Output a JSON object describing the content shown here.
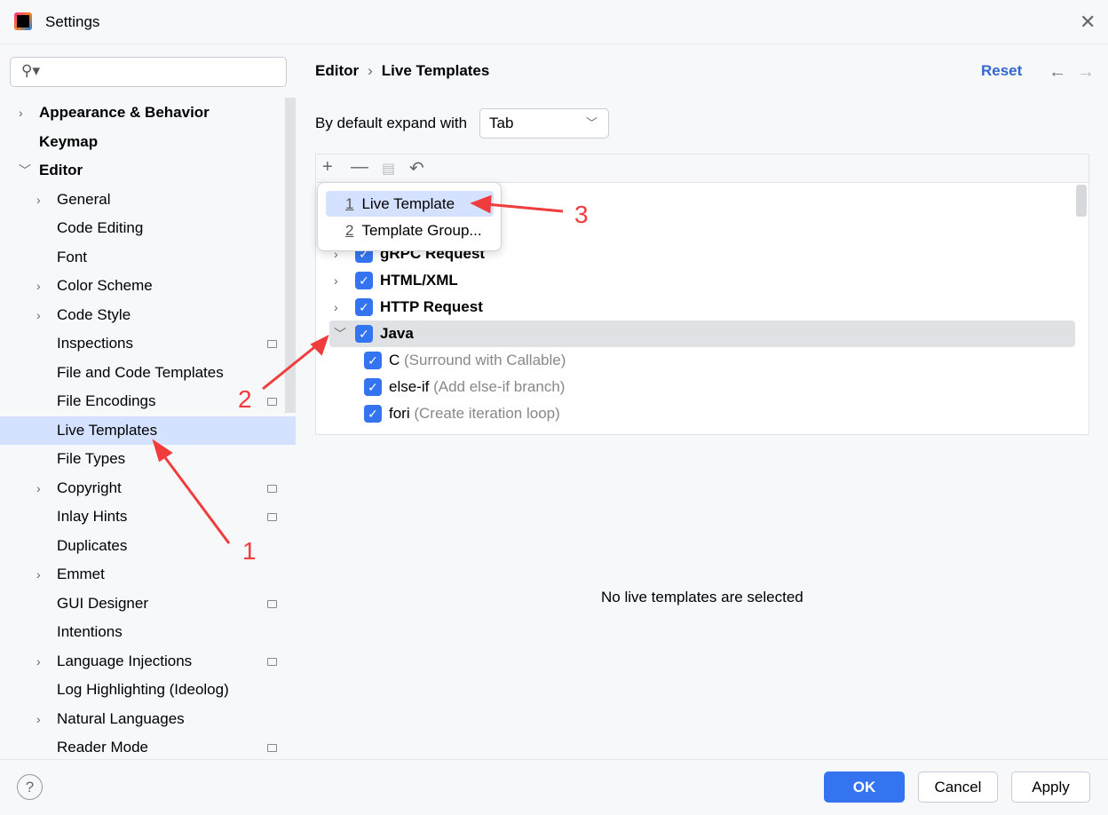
{
  "window": {
    "title": "Settings"
  },
  "search": {
    "placeholder": ""
  },
  "sidebar": {
    "items": [
      {
        "label": "Appearance & Behavior",
        "bold": true,
        "chev": ">",
        "indent": 0
      },
      {
        "label": "Keymap",
        "bold": true,
        "indent": 0
      },
      {
        "label": "Editor",
        "bold": true,
        "chev": "v",
        "indent": 0
      },
      {
        "label": "General",
        "chev": ">",
        "indent": 1
      },
      {
        "label": "Code Editing",
        "indent": 1
      },
      {
        "label": "Font",
        "indent": 1
      },
      {
        "label": "Color Scheme",
        "chev": ">",
        "indent": 1
      },
      {
        "label": "Code Style",
        "chev": ">",
        "indent": 1
      },
      {
        "label": "Inspections",
        "indent": 1,
        "pin": true
      },
      {
        "label": "File and Code Templates",
        "indent": 1
      },
      {
        "label": "File Encodings",
        "indent": 1,
        "pin": true
      },
      {
        "label": "Live Templates",
        "indent": 1,
        "selected": true
      },
      {
        "label": "File Types",
        "indent": 1
      },
      {
        "label": "Copyright",
        "chev": ">",
        "indent": 1,
        "pin": true
      },
      {
        "label": "Inlay Hints",
        "indent": 1,
        "pin": true
      },
      {
        "label": "Duplicates",
        "indent": 1
      },
      {
        "label": "Emmet",
        "chev": ">",
        "indent": 1
      },
      {
        "label": "GUI Designer",
        "indent": 1,
        "pin": true
      },
      {
        "label": "Intentions",
        "indent": 1
      },
      {
        "label": "Language Injections",
        "chev": ">",
        "indent": 1,
        "pin": true
      },
      {
        "label": "Log Highlighting (Ideolog)",
        "indent": 1
      },
      {
        "label": "Natural Languages",
        "chev": ">",
        "indent": 1
      },
      {
        "label": "Reader Mode",
        "indent": 1,
        "pin": true
      }
    ]
  },
  "header": {
    "breadcrumb": [
      "Editor",
      "Live Templates"
    ],
    "reset": "Reset"
  },
  "expand": {
    "label": "By default expand with",
    "value": "Tab"
  },
  "tree": {
    "rows": [
      {
        "name": "gRPC Request",
        "group": true,
        "chev": ">"
      },
      {
        "name": "HTML/XML",
        "group": true,
        "chev": ">"
      },
      {
        "name": "HTTP Request",
        "group": true,
        "chev": ">"
      },
      {
        "name": "Java",
        "group": true,
        "chev": "v",
        "highlight": true
      },
      {
        "name": "C",
        "desc": "(Surround with Callable)"
      },
      {
        "name": "else-if",
        "desc": "(Add else-if branch)"
      },
      {
        "name": "fori",
        "desc": "(Create iteration loop)"
      }
    ]
  },
  "popup": {
    "items": [
      {
        "key": "1",
        "label": "Live Template",
        "selected": true
      },
      {
        "key": "2",
        "label": "Template Group..."
      }
    ]
  },
  "detail": {
    "empty": "No live templates are selected"
  },
  "footer": {
    "ok": "OK",
    "cancel": "Cancel",
    "apply": "Apply",
    "help": "?"
  },
  "annotations": {
    "labels": [
      "1",
      "2",
      "3"
    ],
    "color": "#f03c3c"
  }
}
